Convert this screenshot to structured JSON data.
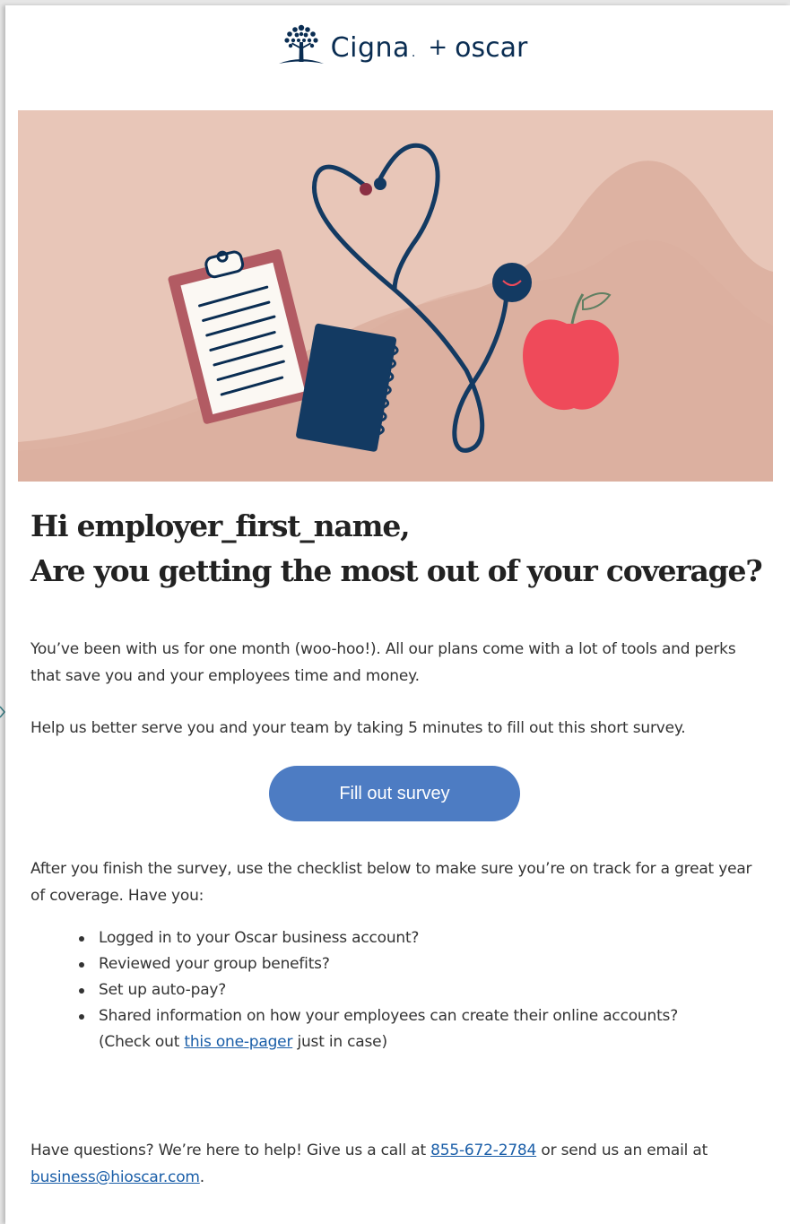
{
  "header": {
    "brand_primary": "Cigna",
    "brand_dot": ".",
    "plus": "+",
    "brand_secondary": "oscar"
  },
  "colors": {
    "navy": "#0a2d52",
    "hero_bg": "#e8c6b8",
    "button": "#4d7cc3",
    "apple": "#ef4a5a",
    "clipboard": "#b25b63",
    "link": "#1a5ea8"
  },
  "hero": {
    "illustration": "clipboard, notebook, stethoscope and apple illustration"
  },
  "greeting": {
    "line1": "Hi employer_first_name,",
    "line2": "Are you getting the most out of your coverage?"
  },
  "intro": {
    "paragraph1": "You’ve been with us for one month (woo-hoo!). All our plans come with a lot of tools and perks that save you and your employees time and money.",
    "paragraph2": "Help us better serve you and your team by taking 5 minutes to fill out this short survey."
  },
  "cta": {
    "label": "Fill out survey"
  },
  "checklist": {
    "intro": "After you finish the survey, use the checklist below to make sure you’re on track for a great year of coverage. Have you:",
    "items": [
      "Logged in to your Oscar business account?",
      "Reviewed your group benefits?",
      "Set up auto-pay?",
      "Shared information on how your employees can create their online accounts?"
    ],
    "note_prefix": "(Check out ",
    "note_link": "this one-pager",
    "note_suffix": " just in case)"
  },
  "footer": {
    "text_prefix": "Have questions? We’re here to help! Give us a call at ",
    "phone": "855-672-2784",
    "text_middle": " or send us an email at ",
    "email": "business@hioscar.com",
    "text_suffix": "."
  }
}
